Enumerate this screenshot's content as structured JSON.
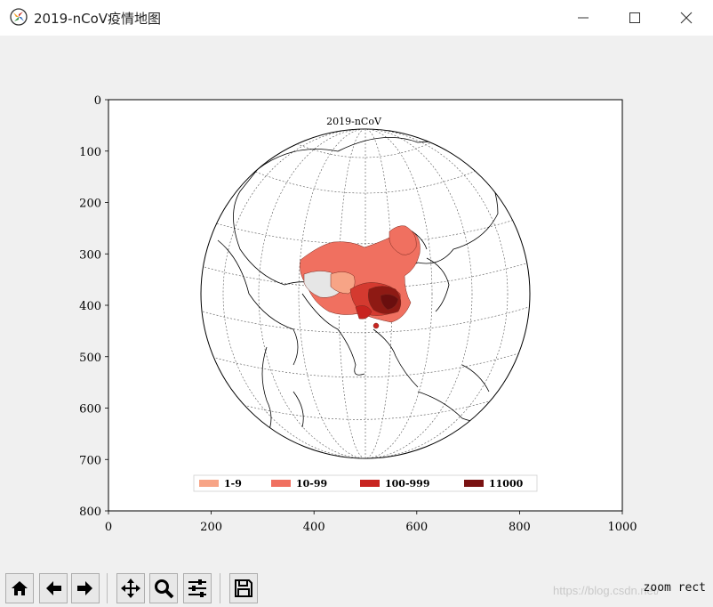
{
  "window": {
    "title": "2019-nCoV疫情地图",
    "controls": {
      "minimize": "minimize-icon",
      "maximize": "maximize-icon",
      "close": "close-icon"
    }
  },
  "plot": {
    "title": "2019-nCoV",
    "x_ticks": [
      "0",
      "200",
      "400",
      "600",
      "800",
      "1000"
    ],
    "y_ticks": [
      "0",
      "100",
      "200",
      "300",
      "400",
      "500",
      "600",
      "700",
      "800"
    ],
    "xlim": [
      0,
      1000
    ],
    "ylim": [
      800,
      0
    ],
    "legend": [
      {
        "label": "1-9",
        "color": "#f7a486"
      },
      {
        "label": "10-99",
        "color": "#f07060"
      },
      {
        "label": "100-999",
        "color": "#c82420"
      },
      {
        "label": "11000",
        "color": "#7a1212"
      }
    ]
  },
  "toolbar": {
    "buttons": [
      {
        "name": "home-button",
        "icon": "home-icon"
      },
      {
        "name": "back-button",
        "icon": "arrow-left-icon"
      },
      {
        "name": "forward-button",
        "icon": "arrow-right-icon"
      },
      {
        "name": "pan-button",
        "icon": "move-icon"
      },
      {
        "name": "zoom-button",
        "icon": "magnifier-icon"
      },
      {
        "name": "configure-subplots-button",
        "icon": "sliders-icon"
      },
      {
        "name": "save-button",
        "icon": "floppy-disk-icon"
      }
    ],
    "status": "zoom rect",
    "watermark": "https://blog.csdn.net/"
  }
}
